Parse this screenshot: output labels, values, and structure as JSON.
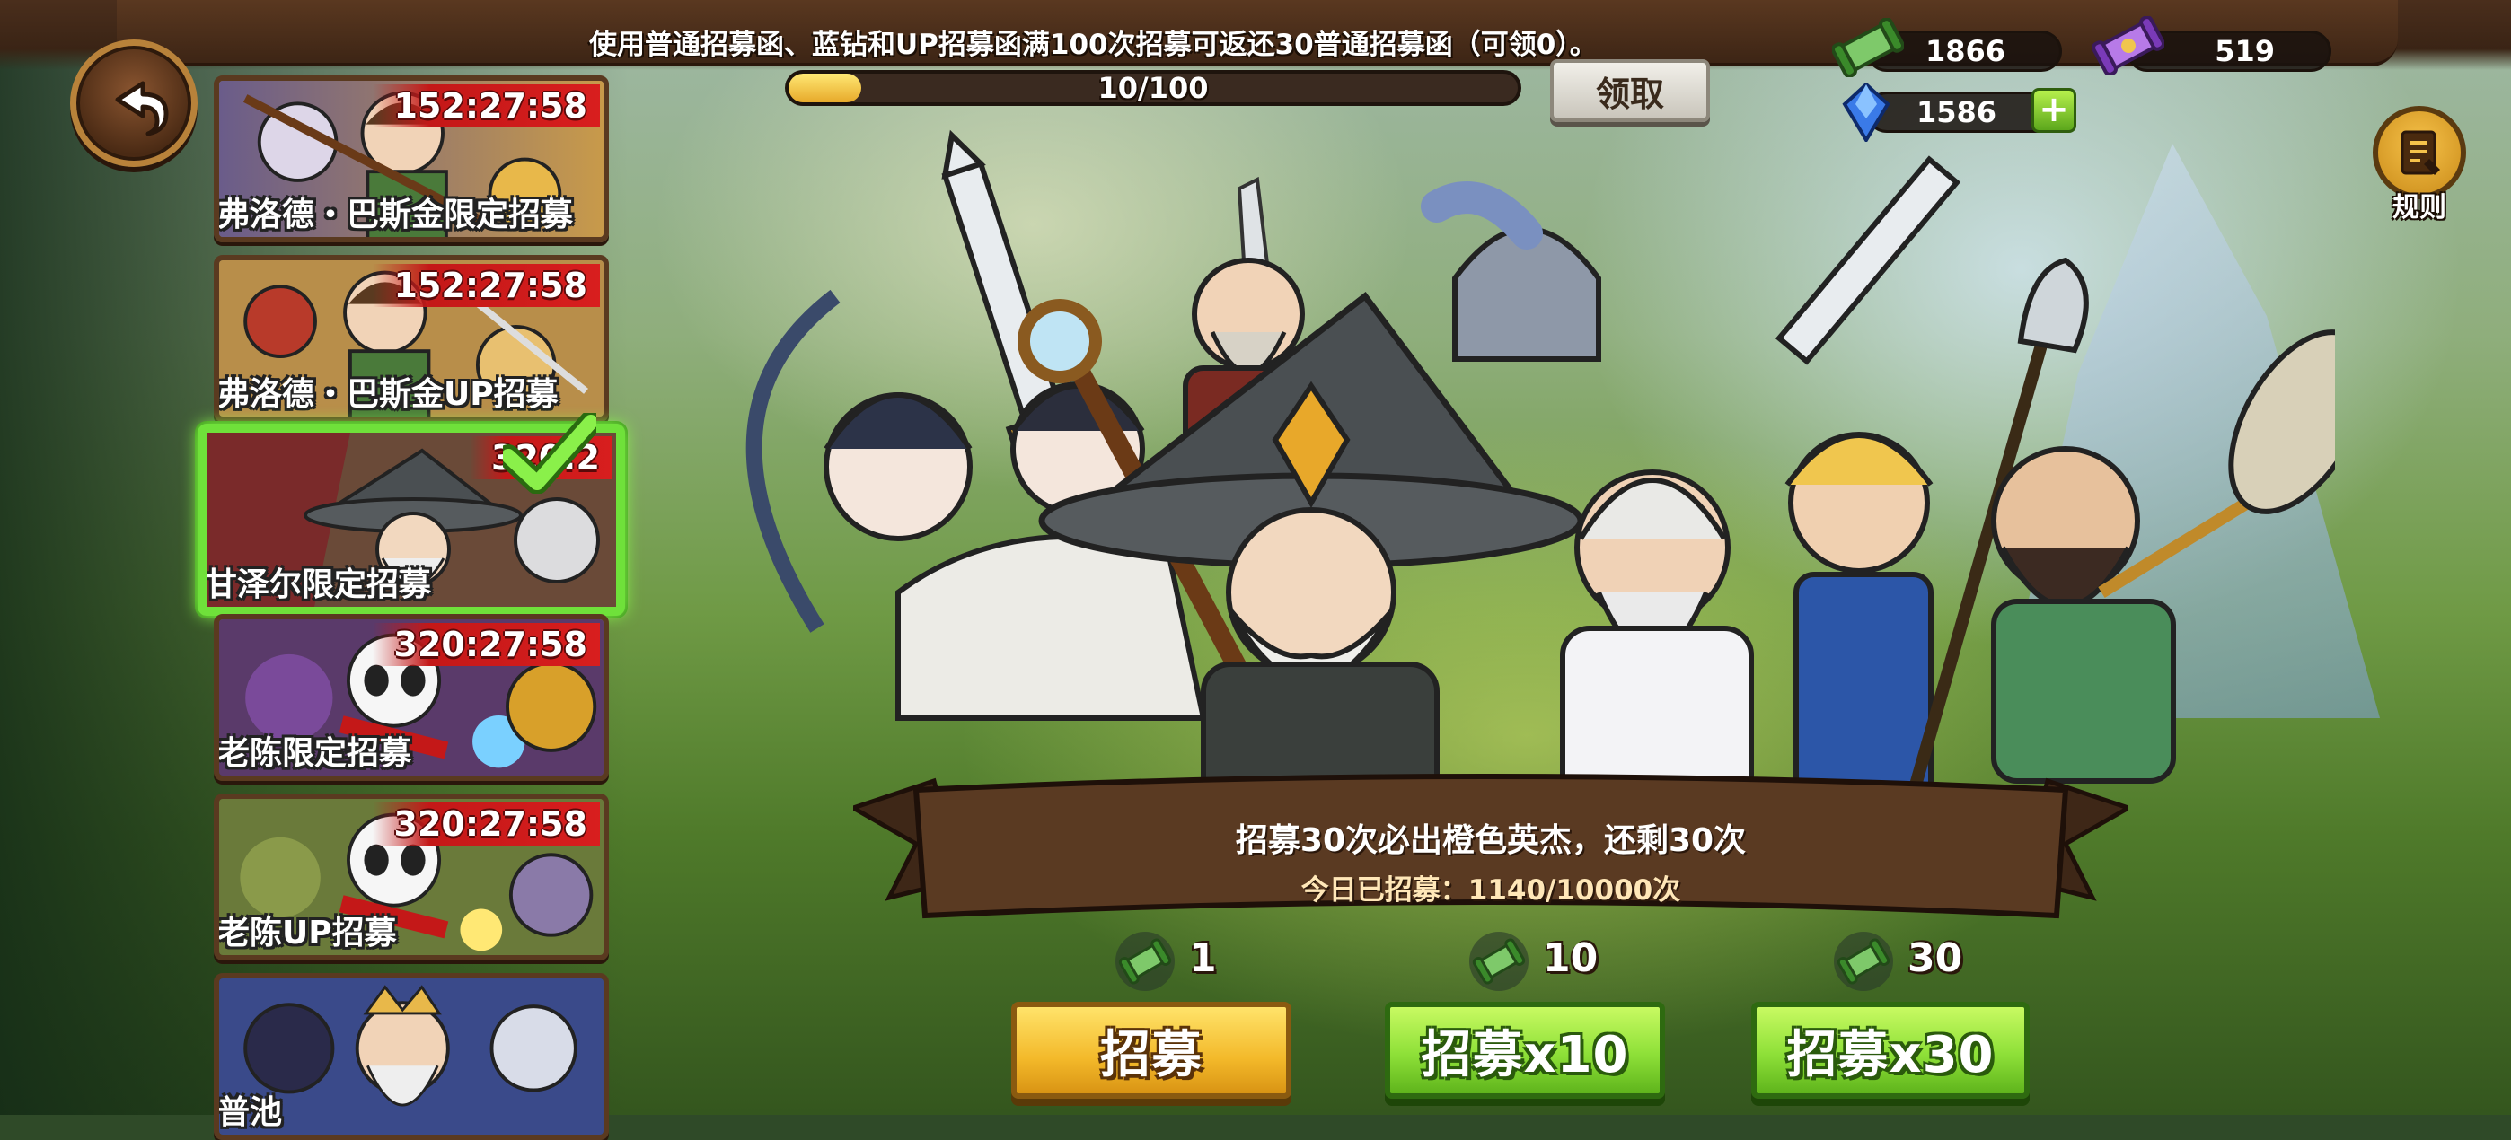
{
  "promo": {
    "text": "使用普通招募函、蓝钻和UP招募函满100次招募可返还30普通招募函（可领0）。",
    "progress_text": "10/100",
    "progress_fraction": 0.1,
    "claim_label": "领取"
  },
  "currencies": {
    "scroll_green": "1866",
    "scroll_purple": "519",
    "diamond": "1586",
    "plus_label": "+"
  },
  "rules": {
    "label": "规则"
  },
  "banners": [
    {
      "name": "弗洛德・巴斯金限定招募",
      "timer": "152:27:58",
      "selected": false
    },
    {
      "name": "弗洛德・巴斯金UP招募",
      "timer": "152:27:58",
      "selected": false
    },
    {
      "name": "甘泽尔限定招募",
      "timer": "320:2",
      "selected": true
    },
    {
      "name": "老陈限定招募",
      "timer": "320:27:58",
      "selected": false
    },
    {
      "name": "老陈UP招募",
      "timer": "320:27:58",
      "selected": false
    },
    {
      "name": "普池",
      "timer": "",
      "selected": false
    }
  ],
  "ribbon": {
    "line1": "招募30次必出橙色英杰，还剩30次",
    "line2": "今日已招募：1140/10000次"
  },
  "recruit": [
    {
      "cost": "1",
      "label": "招募",
      "style": "yellow"
    },
    {
      "cost": "10",
      "label": "招募x10",
      "style": "green"
    },
    {
      "cost": "30",
      "label": "招募x30",
      "style": "green"
    }
  ],
  "colors": {
    "selected_border": "#6fe13a",
    "timer_red": "#d81e1e",
    "yellow_button": "#f3b92a",
    "green_button": "#8ee038"
  },
  "icons": {
    "back": "back-arrow-icon",
    "check": "check-icon",
    "scroll": "recruit-scroll-icon",
    "diamond": "blue-diamond-icon",
    "rules": "rules-book-icon"
  }
}
